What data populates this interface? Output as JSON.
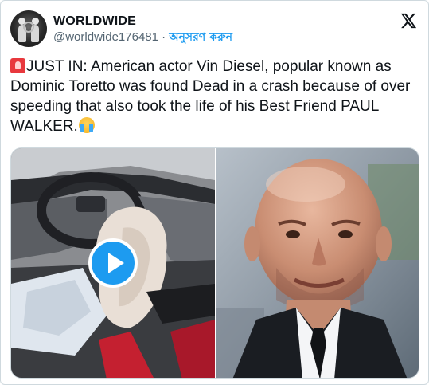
{
  "account": {
    "display_name": "WORLDWIDE",
    "handle": "@worldwide176481",
    "separator": "·",
    "follow_label": "অনুসরণ করুন"
  },
  "tweet": {
    "text": "JUST IN: American actor Vin Diesel, popular known as Dominic Toretto was found Dead in a crash because of over speeding that also took the life of his Best Friend PAUL WALKER."
  },
  "icons": {
    "avatar": "avatar-logo-icon",
    "brand": "x-logo-icon",
    "siren": "siren-emoji-icon",
    "cry": "crying-face-emoji-icon",
    "play": "play-icon"
  },
  "media": [
    {
      "kind": "video",
      "subject": "car interior with deployed airbag"
    },
    {
      "kind": "photo",
      "subject": "bald man in suit and tie"
    }
  ],
  "colors": {
    "accent": "#1d9bf0",
    "text": "#0f1419",
    "muted": "#536471",
    "border": "#cfd9de"
  }
}
